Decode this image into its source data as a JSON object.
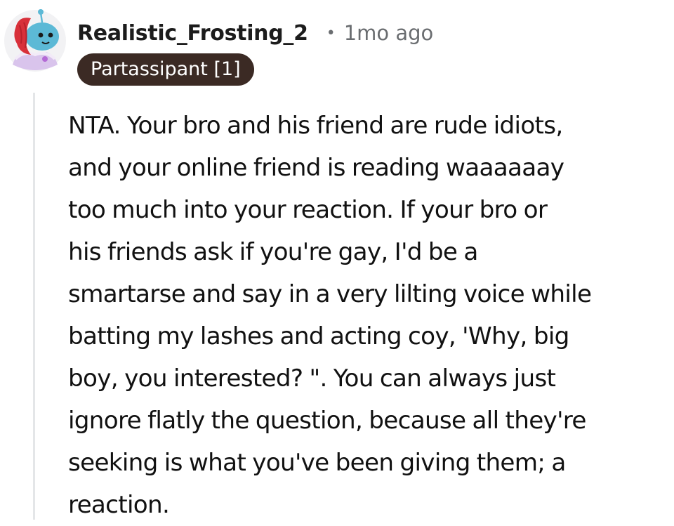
{
  "comment": {
    "author": "Realistic_Frosting_2",
    "separator": "•",
    "timestamp": "1mo ago",
    "flair": "Partassipant [1]",
    "avatar_icon": "snoo-avatar-icon",
    "body_lines": [
      "NTA. Your bro and his friend are rude idiots,",
      "and your online friend is reading waaaaaay",
      "too much into your reaction. If your bro or",
      "his friends ask if you're gay, I'd be a",
      "smartarse and say in a very lilting voice while",
      "batting my lashes and acting coy, 'Why, big",
      "boy, you interested? \". You can always just",
      "ignore flatly the question, because all they're",
      "seeking is what you've been giving them; a",
      "reaction."
    ]
  },
  "colors": {
    "flair_background": "#3b2a24",
    "flair_text": "#ffffff",
    "meta_text": "#6a6d70",
    "thread_line": "#e4e6e8",
    "body_text": "#111111"
  }
}
